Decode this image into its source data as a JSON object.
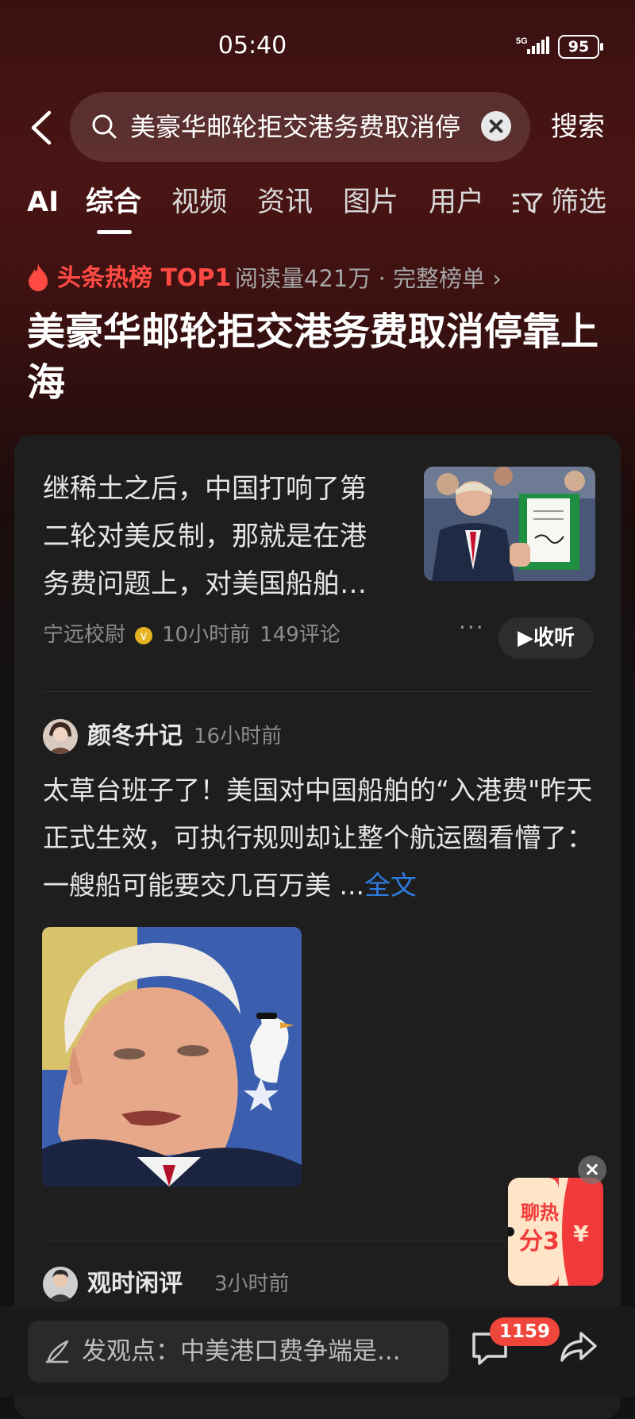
{
  "status_bar": {
    "time": "05:40",
    "network": "5G",
    "battery": "95"
  },
  "search": {
    "query": "美豪华邮轮拒交港务费取消停",
    "button": "搜索"
  },
  "tabs": [
    {
      "label": "AI"
    },
    {
      "label": "综合",
      "active": true
    },
    {
      "label": "视频"
    },
    {
      "label": "资讯"
    },
    {
      "label": "图片"
    },
    {
      "label": "用户"
    },
    {
      "label": "筛选"
    }
  ],
  "hot": {
    "label": "头条热榜 TOP1",
    "meta": "阅读量421万 · 完整榜单 ›",
    "color": "#ff4a43"
  },
  "headline": "美豪华邮轮拒交港务费取消停靠上海",
  "article": {
    "text": "继稀土之后，中国打响了第二轮对美反制，那就是在港务费问题上，对美国船舶…",
    "author": "宁远校尉",
    "verified_icon": "v",
    "time": "10小时前",
    "comments": "149评论",
    "more": "···",
    "listen": "收听"
  },
  "posts": [
    {
      "author": "颜冬升记",
      "time": "16小时前",
      "text": "太草台班子了！美国对中国船舶的“入港费\"昨天正式生效，可执行规则却让整个航运圈看懵了：一艘船可能要交几百万美  ...",
      "full_link": "全文"
    },
    {
      "author": "观时闲评",
      "time": "3小时前"
    }
  ],
  "promo": {
    "line1": "聊热",
    "line2": "分3",
    "currency": "¥"
  },
  "bottom": {
    "comment_placeholder": "发观点：中美港口费争端是...",
    "comment_count": "1159"
  },
  "colors": {
    "accent_red": "#f0453a",
    "link_blue": "#2f7be0"
  }
}
